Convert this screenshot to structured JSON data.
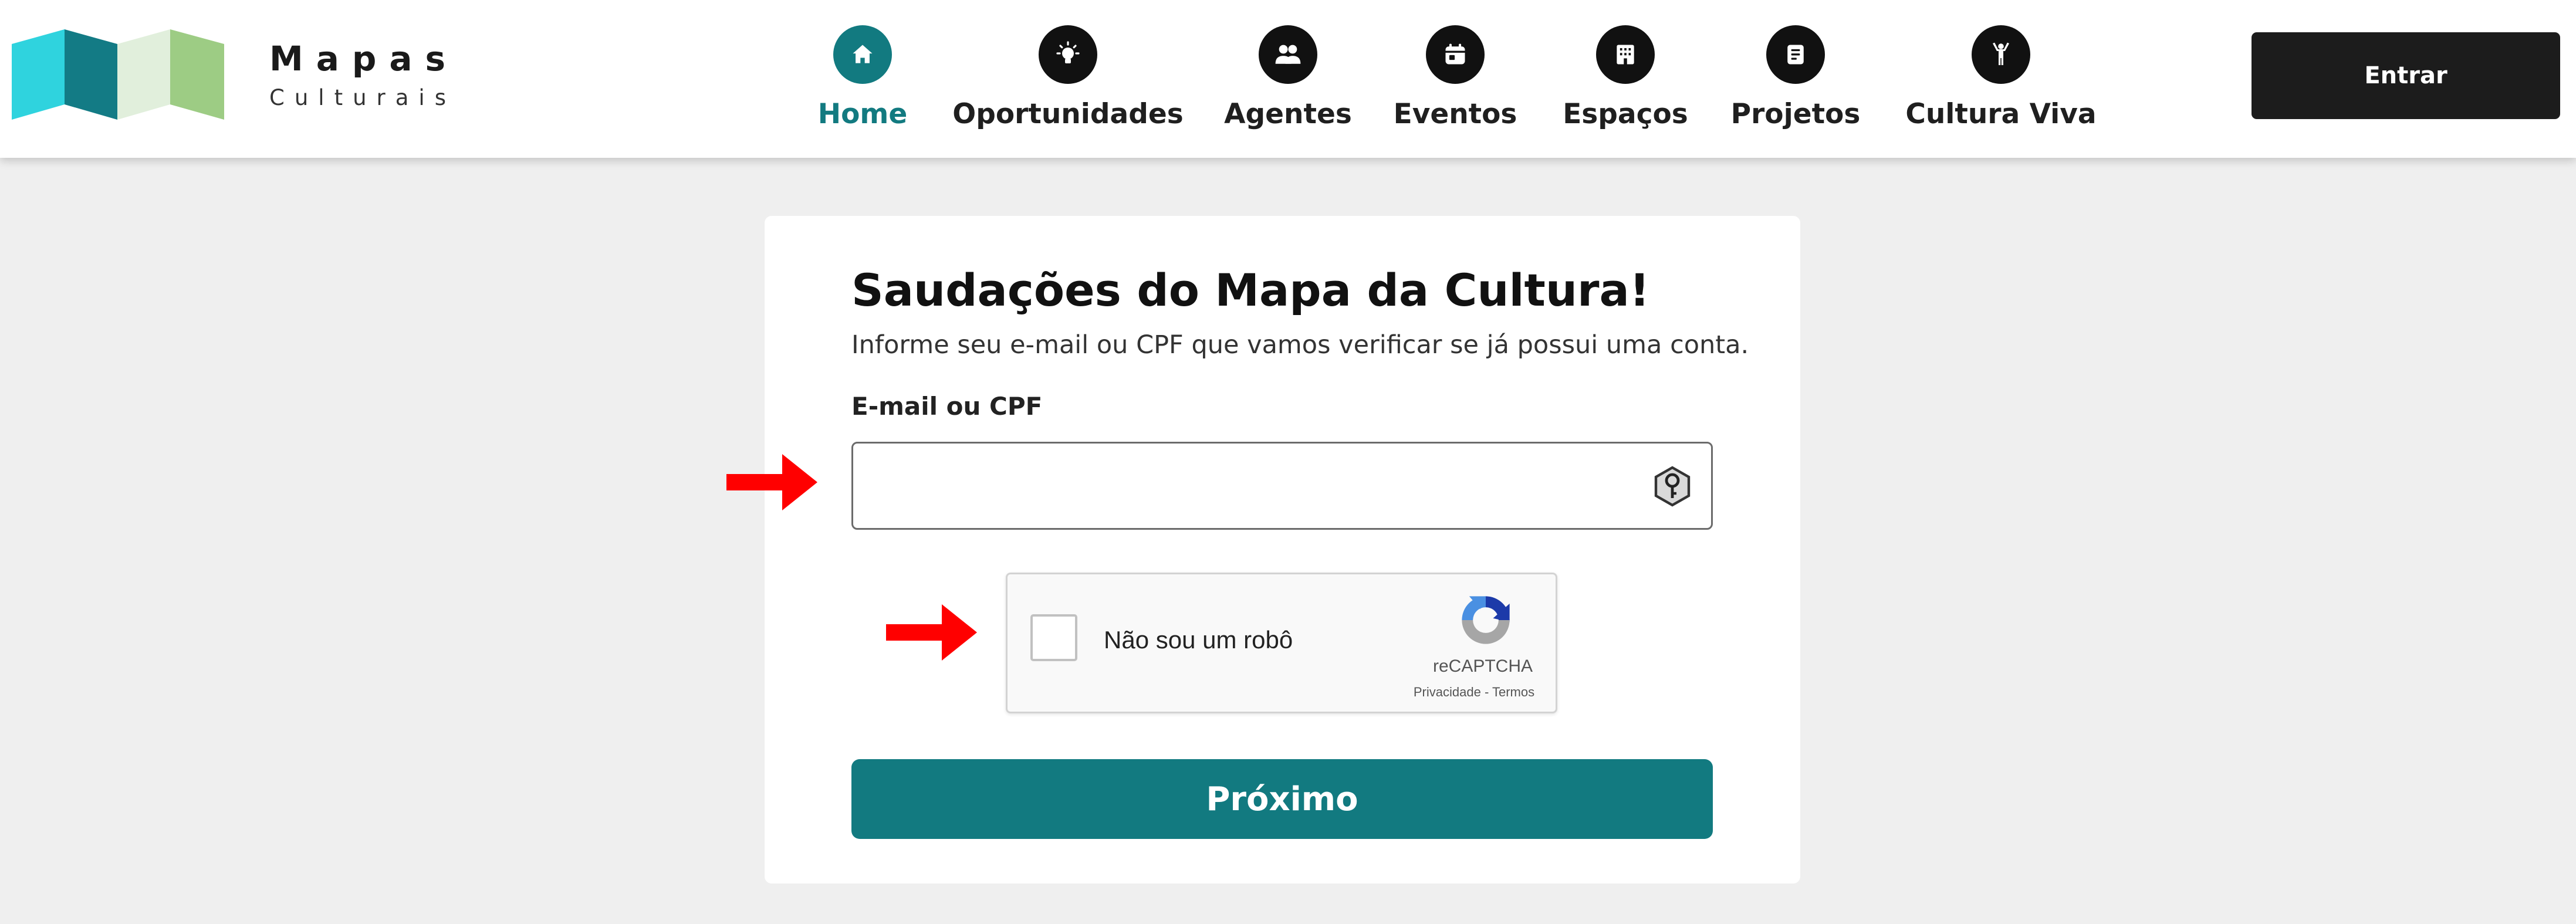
{
  "header": {
    "brand_name": "Mapas",
    "brand_sub": "Culturais",
    "nav": [
      {
        "label": "Home",
        "icon": "home-icon",
        "active": true
      },
      {
        "label": "Oportunidades",
        "icon": "lightbulb-icon",
        "active": false
      },
      {
        "label": "Agentes",
        "icon": "people-icon",
        "active": false
      },
      {
        "label": "Eventos",
        "icon": "calendar-icon",
        "active": false
      },
      {
        "label": "Espaços",
        "icon": "building-icon",
        "active": false
      },
      {
        "label": "Projetos",
        "icon": "document-icon",
        "active": false
      },
      {
        "label": "Cultura Viva",
        "icon": "person-raised-arms-icon",
        "active": false
      }
    ],
    "login_label": "Entrar"
  },
  "login_card": {
    "title": "Saudações do Mapa da Cultura!",
    "description": "Informe seu e-mail ou CPF que vamos verificar se já possui uma conta.",
    "field_label": "E-mail ou CPF",
    "field_value": "",
    "field_placeholder": "",
    "recaptcha": {
      "label": "Não sou um robô",
      "brand": "reCAPTCHA",
      "terms": "Privacidade - Termos",
      "checked": false
    },
    "next_label": "Próximo"
  },
  "colors": {
    "accent": "#127a80",
    "dark_button": "#1c1c1c",
    "nav_icon_bg": "#111111",
    "arrow": "#ff0000",
    "page_bg": "#efefef"
  }
}
